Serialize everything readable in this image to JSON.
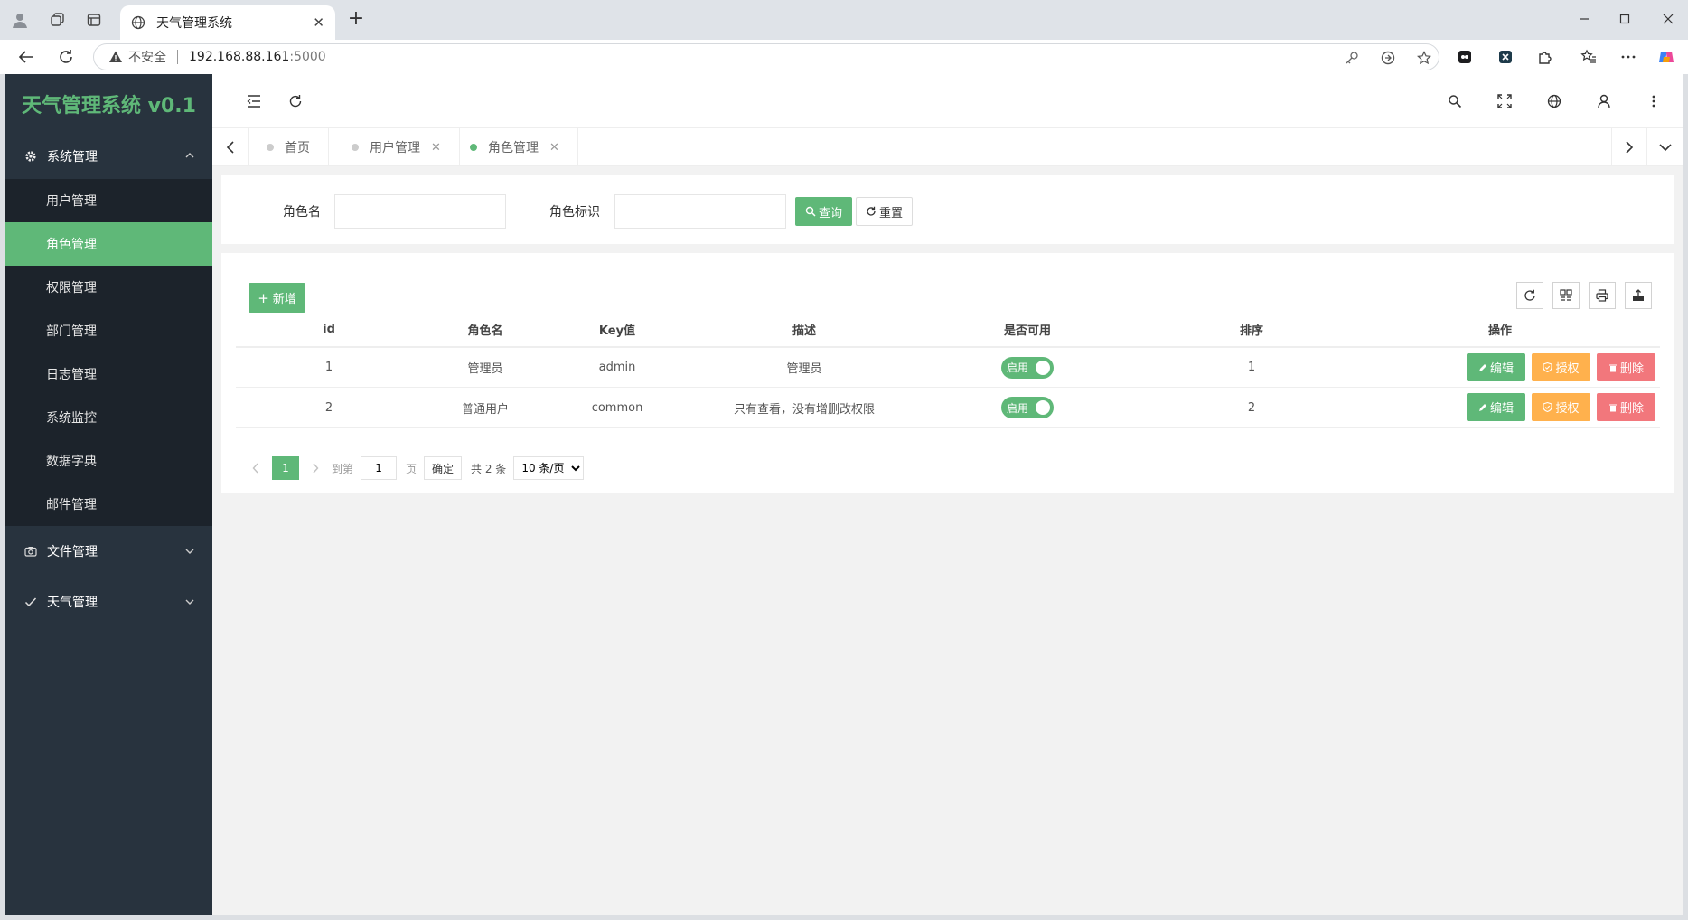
{
  "browser": {
    "tab_title": "天气管理系统",
    "insecure_label": "不安全",
    "url_host": "192.168.88.161",
    "url_port": ":5000"
  },
  "sidebar": {
    "logo": "天气管理系统 v0.1",
    "groups": [
      {
        "label": "系统管理",
        "icon": "gear-icon",
        "expanded": true,
        "items": [
          {
            "label": "用户管理",
            "active": false
          },
          {
            "label": "角色管理",
            "active": true
          },
          {
            "label": "权限管理",
            "active": false
          },
          {
            "label": "部门管理",
            "active": false
          },
          {
            "label": "日志管理",
            "active": false
          },
          {
            "label": "系统监控",
            "active": false
          },
          {
            "label": "数据字典",
            "active": false
          },
          {
            "label": "邮件管理",
            "active": false
          }
        ]
      },
      {
        "label": "文件管理",
        "icon": "camera-icon",
        "expanded": false
      },
      {
        "label": "天气管理",
        "icon": "check-icon",
        "expanded": false
      }
    ]
  },
  "tabs": [
    {
      "label": "首页",
      "closable": false,
      "active": false
    },
    {
      "label": "用户管理",
      "closable": true,
      "active": false
    },
    {
      "label": "角色管理",
      "closable": true,
      "active": true
    }
  ],
  "search": {
    "role_name_label": "角色名",
    "role_name_value": "",
    "role_key_label": "角色标识",
    "role_key_value": "",
    "query_label": "查询",
    "reset_label": "重置"
  },
  "table": {
    "add_label": "新增",
    "columns": [
      "id",
      "角色名",
      "Key值",
      "描述",
      "是否可用",
      "排序",
      "操作"
    ],
    "rows": [
      {
        "id": "1",
        "name": "管理员",
        "key": "admin",
        "desc": "管理员",
        "status": "启用",
        "sort": "1"
      },
      {
        "id": "2",
        "name": "普通用户",
        "key": "common",
        "desc": "只有查看，没有增删改权限",
        "status": "启用",
        "sort": "2"
      }
    ],
    "edit_label": "编辑",
    "grant_label": "授权",
    "delete_label": "删除"
  },
  "pager": {
    "current_page": "1",
    "goto_label": "到第",
    "goto_value": "1",
    "page_unit": "页",
    "confirm_label": "确定",
    "total_label": "共 2 条",
    "page_size": "10 条/页"
  },
  "colors": {
    "accent": "#5fb878",
    "sidebar_bg": "#28333e",
    "submenu_bg": "#1c232b",
    "warn": "#ffb14d",
    "danger": "#f2777c"
  }
}
